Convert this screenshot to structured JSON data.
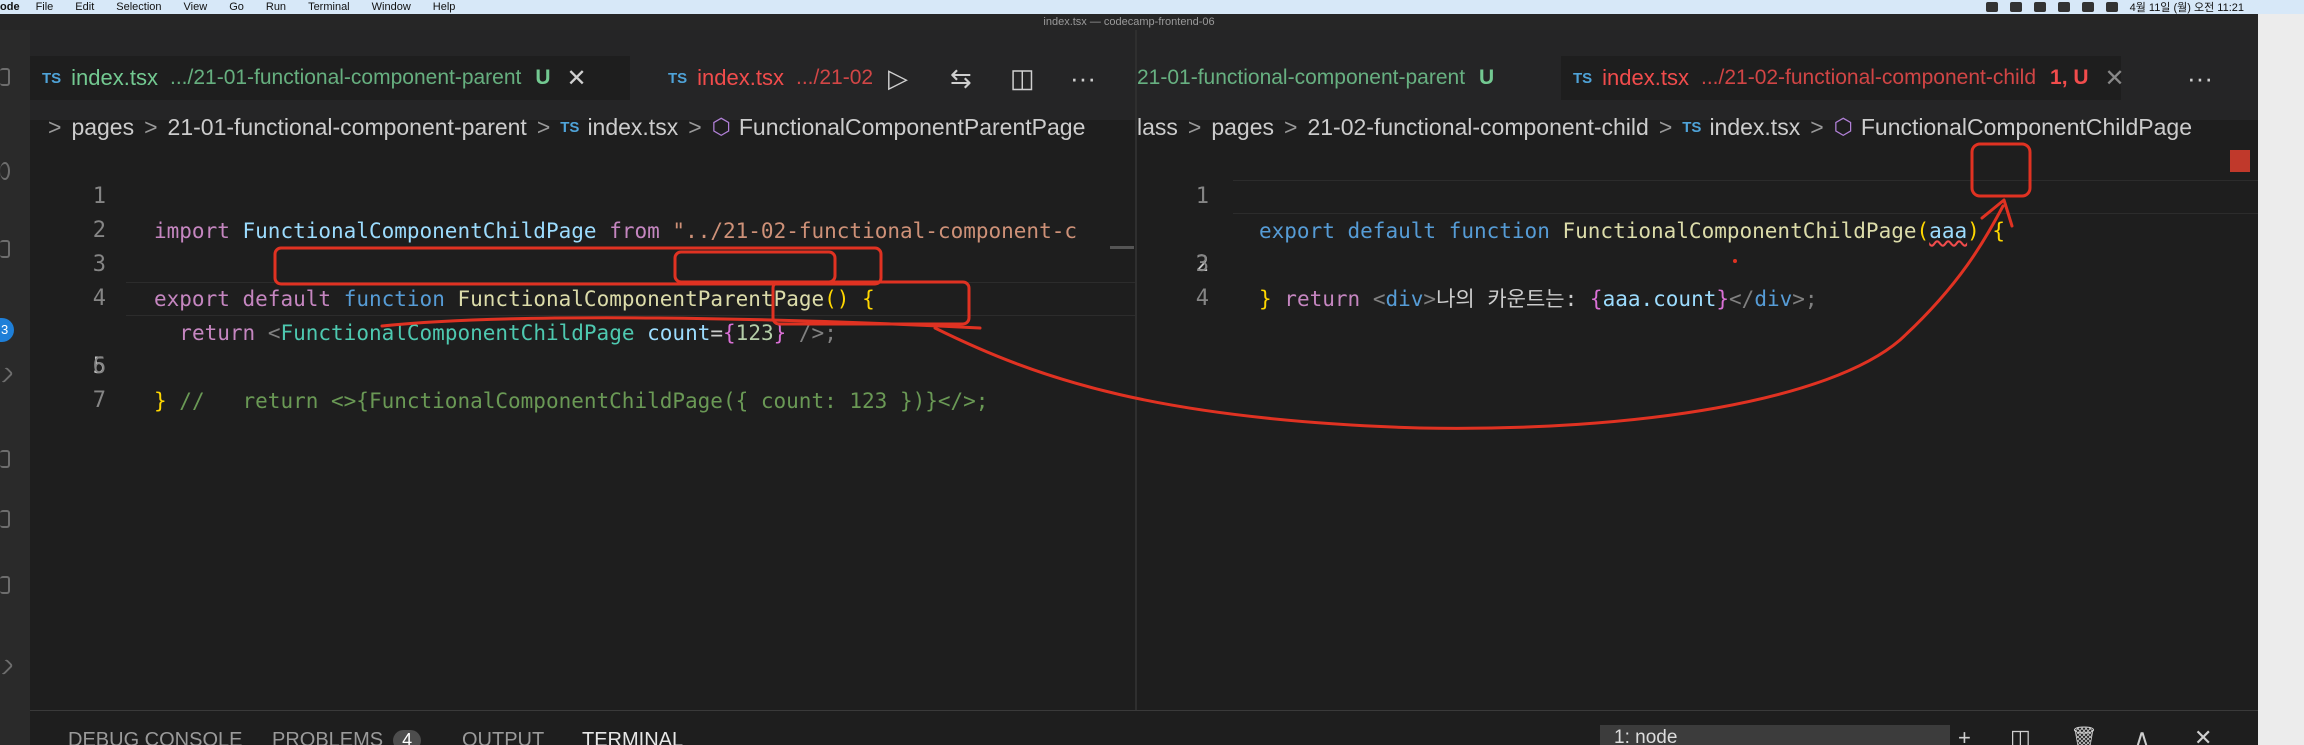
{
  "menubar": {
    "app": "ode",
    "items": [
      "File",
      "Edit",
      "Selection",
      "View",
      "Go",
      "Run",
      "Terminal",
      "Window",
      "Help"
    ],
    "clock": "4월 11일 (월) 오전 11:21"
  },
  "window": {
    "title": "index.tsx — codecamp-frontend-06"
  },
  "activity": {
    "badge": "3"
  },
  "left": {
    "tab_active": {
      "icon": "TS",
      "name": "index.tsx",
      "path": ".../21-01-functional-component-parent",
      "status": "U",
      "close": "✕"
    },
    "tab_second": {
      "icon": "TS",
      "name": "index.tsx",
      "path": ".../21-02"
    },
    "actions": {
      "run": "▷",
      "compare": "⇆",
      "split": "◫",
      "more": "···"
    },
    "breadcrumb": {
      "items": [
        "pages",
        "21-01-functional-component-parent"
      ],
      "file": "index.tsx",
      "symbol": "FunctionalComponentParentPage",
      "sep": ">",
      "ts": "TS",
      "sym_icon": "⬡"
    },
    "lines": [
      {
        "n": "1",
        "t": {
          "kw": "import",
          "fn": "FunctionalComponentChildPage",
          "from": "from",
          "str": "\"../21-02-functional-component-c"
        }
      },
      {
        "n": "2"
      },
      {
        "n": "3",
        "t": {
          "kw": "export",
          "def": "default",
          "func": "function",
          "fn": "FunctionalComponentParentPage",
          "paren": "()",
          "brace": "{"
        }
      },
      {
        "n": "4",
        "t": {
          "ret": "return",
          "open": "<",
          "tag": "FunctionalComponentChildPage",
          "attr": "count",
          "eq": "=",
          "b1": "{",
          "num": "123",
          "b2": "}",
          "close": " />;"
        }
      },
      {
        "n": "5",
        "t": {
          "cm": "//   return <>{FunctionalComponentChildPage({ count: 123 })}</>;"
        }
      },
      {
        "n": "6",
        "t": {
          "brace": "}"
        }
      },
      {
        "n": "7"
      }
    ]
  },
  "right": {
    "tab_partial": {
      "path": "21-01-functional-component-parent",
      "status": "U"
    },
    "tab_active": {
      "icon": "TS",
      "name": "index.tsx",
      "path": ".../21-02-functional-component-child",
      "status": "1, U",
      "close": "✕"
    },
    "more": "···",
    "breadcrumb": {
      "prefix": "lass",
      "items": [
        "pages",
        "21-02-functional-component-child"
      ],
      "file": "index.tsx",
      "symbol": "FunctionalComponentChildPage",
      "sep": ">",
      "ts": "TS",
      "sym_icon": "⬡"
    },
    "lines": [
      {
        "n": "1",
        "t": {
          "kw": "export",
          "def": "default",
          "func": "function",
          "fn": "FunctionalComponentChildPage",
          "po": "(",
          "param": "aaa",
          "pc": ")",
          "brace": "{"
        }
      },
      {
        "n": "2",
        "t": {
          "ret": "return",
          "lt": "<",
          "tag": "div",
          "gt": ">",
          "text": "나의 카운트는: ",
          "b1": "{",
          "expr": "aaa.count",
          "b2": "}",
          "ltc": "</",
          "tag2": "div",
          "gtc": ">;"
        }
      },
      {
        "n": "3",
        "t": {
          "brace": "}"
        }
      },
      {
        "n": "4"
      }
    ]
  },
  "panel": {
    "tabs": [
      "DEBUG CONSOLE",
      "PROBLEMS",
      "OUTPUT",
      "TERMINAL"
    ],
    "problems_count": "4",
    "terminal_select": "1: node",
    "icons": {
      "add": "+",
      "split": "◫",
      "trash": "🗑",
      "up": "∧",
      "close": "✕"
    }
  },
  "annotation_color": "#e03222"
}
